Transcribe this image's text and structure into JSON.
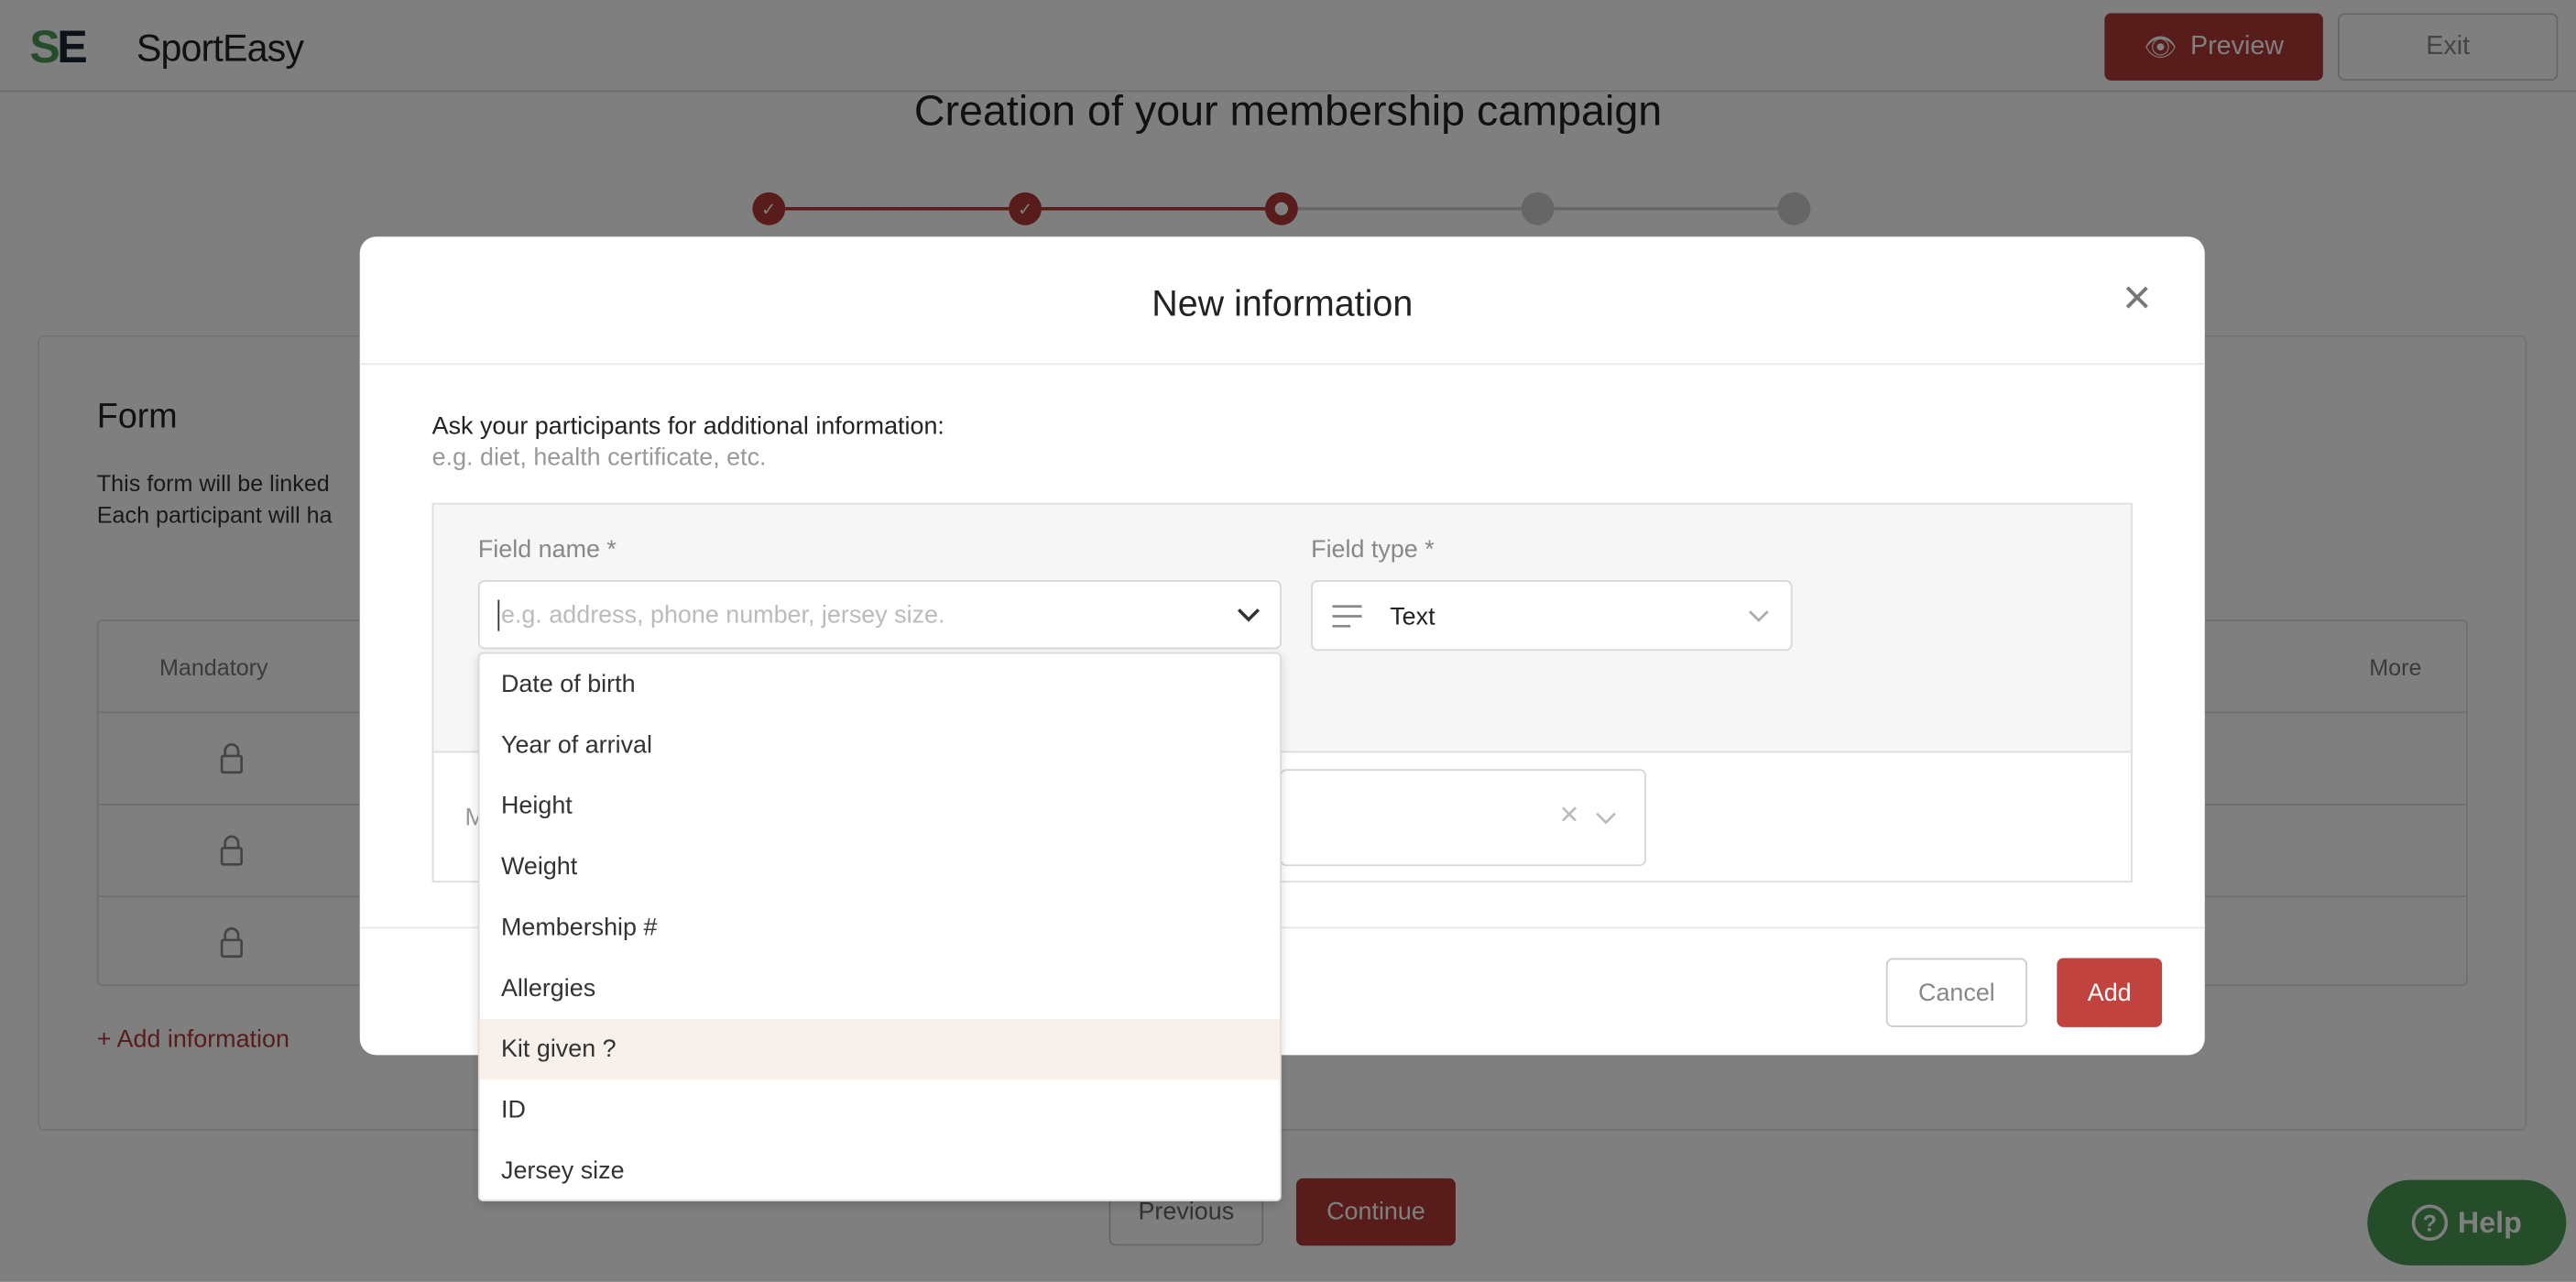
{
  "header": {
    "brand": "SportEasy",
    "logo_letters": "SE",
    "preview_label": "Preview",
    "exit_label": "Exit"
  },
  "page": {
    "title": "Creation of your membership campaign",
    "steps": [
      {
        "state": "done"
      },
      {
        "state": "done"
      },
      {
        "state": "current"
      },
      {
        "state": "todo"
      },
      {
        "state": "todo"
      }
    ],
    "form": {
      "title": "Form",
      "line1": "This form will be linked",
      "line2": "Each participant will ha",
      "columns": {
        "mandatory": "Mandatory",
        "more": "More"
      },
      "rows": [
        {
          "locked": true
        },
        {
          "locked": true
        },
        {
          "locked": true
        }
      ],
      "add_label": "+ Add information"
    },
    "previous_label": "Previous",
    "continue_label": "Continue",
    "help_label": "Help"
  },
  "modal": {
    "title": "New information",
    "intro": "Ask your participants for additional information:",
    "hint": "e.g. diet, health certificate, etc.",
    "field_name_label": "Field name *",
    "field_name_placeholder": "e.g. address, phone number, jersey size.",
    "field_name_value": "",
    "field_type_label": "Field type *",
    "field_type_value": "Text",
    "second_row_label": "M",
    "cancel_label": "Cancel",
    "add_label": "Add",
    "options": [
      "Date of birth",
      "Year of arrival",
      "Height",
      "Weight",
      "Membership #",
      "Allergies",
      "Kit given ?",
      "ID",
      "Jersey size"
    ],
    "highlighted_option": "Kit given ?"
  },
  "colors": {
    "brand_red": "#b03a35",
    "add_red": "#c0433f",
    "help_green": "#4a9a55",
    "highlight": "#f8f0eb"
  }
}
